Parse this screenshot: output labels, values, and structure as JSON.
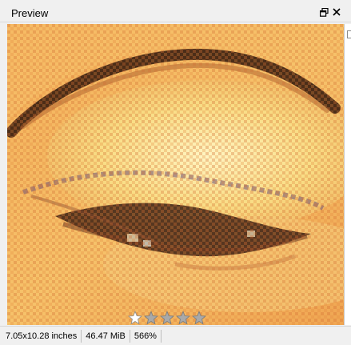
{
  "window": {
    "title": "Preview",
    "float_icon": "restore-window-icon",
    "close_icon": "close-icon"
  },
  "image": {
    "description_icon": "zoomed-eye-image",
    "palette": {
      "skin_light": "#f8e08a",
      "skin_mid": "#f2b35a",
      "skin_dark": "#d9783a",
      "lash": "#2a1a14",
      "highlight": "#fff2b8"
    }
  },
  "rating": {
    "value": 1,
    "max": 5,
    "filled_color": "#ffffff",
    "empty_color": "#a9a9a9"
  },
  "status": {
    "dimensions": "7.05x10.28 inches",
    "file_size": "46.47 MiB",
    "zoom": "566%"
  }
}
